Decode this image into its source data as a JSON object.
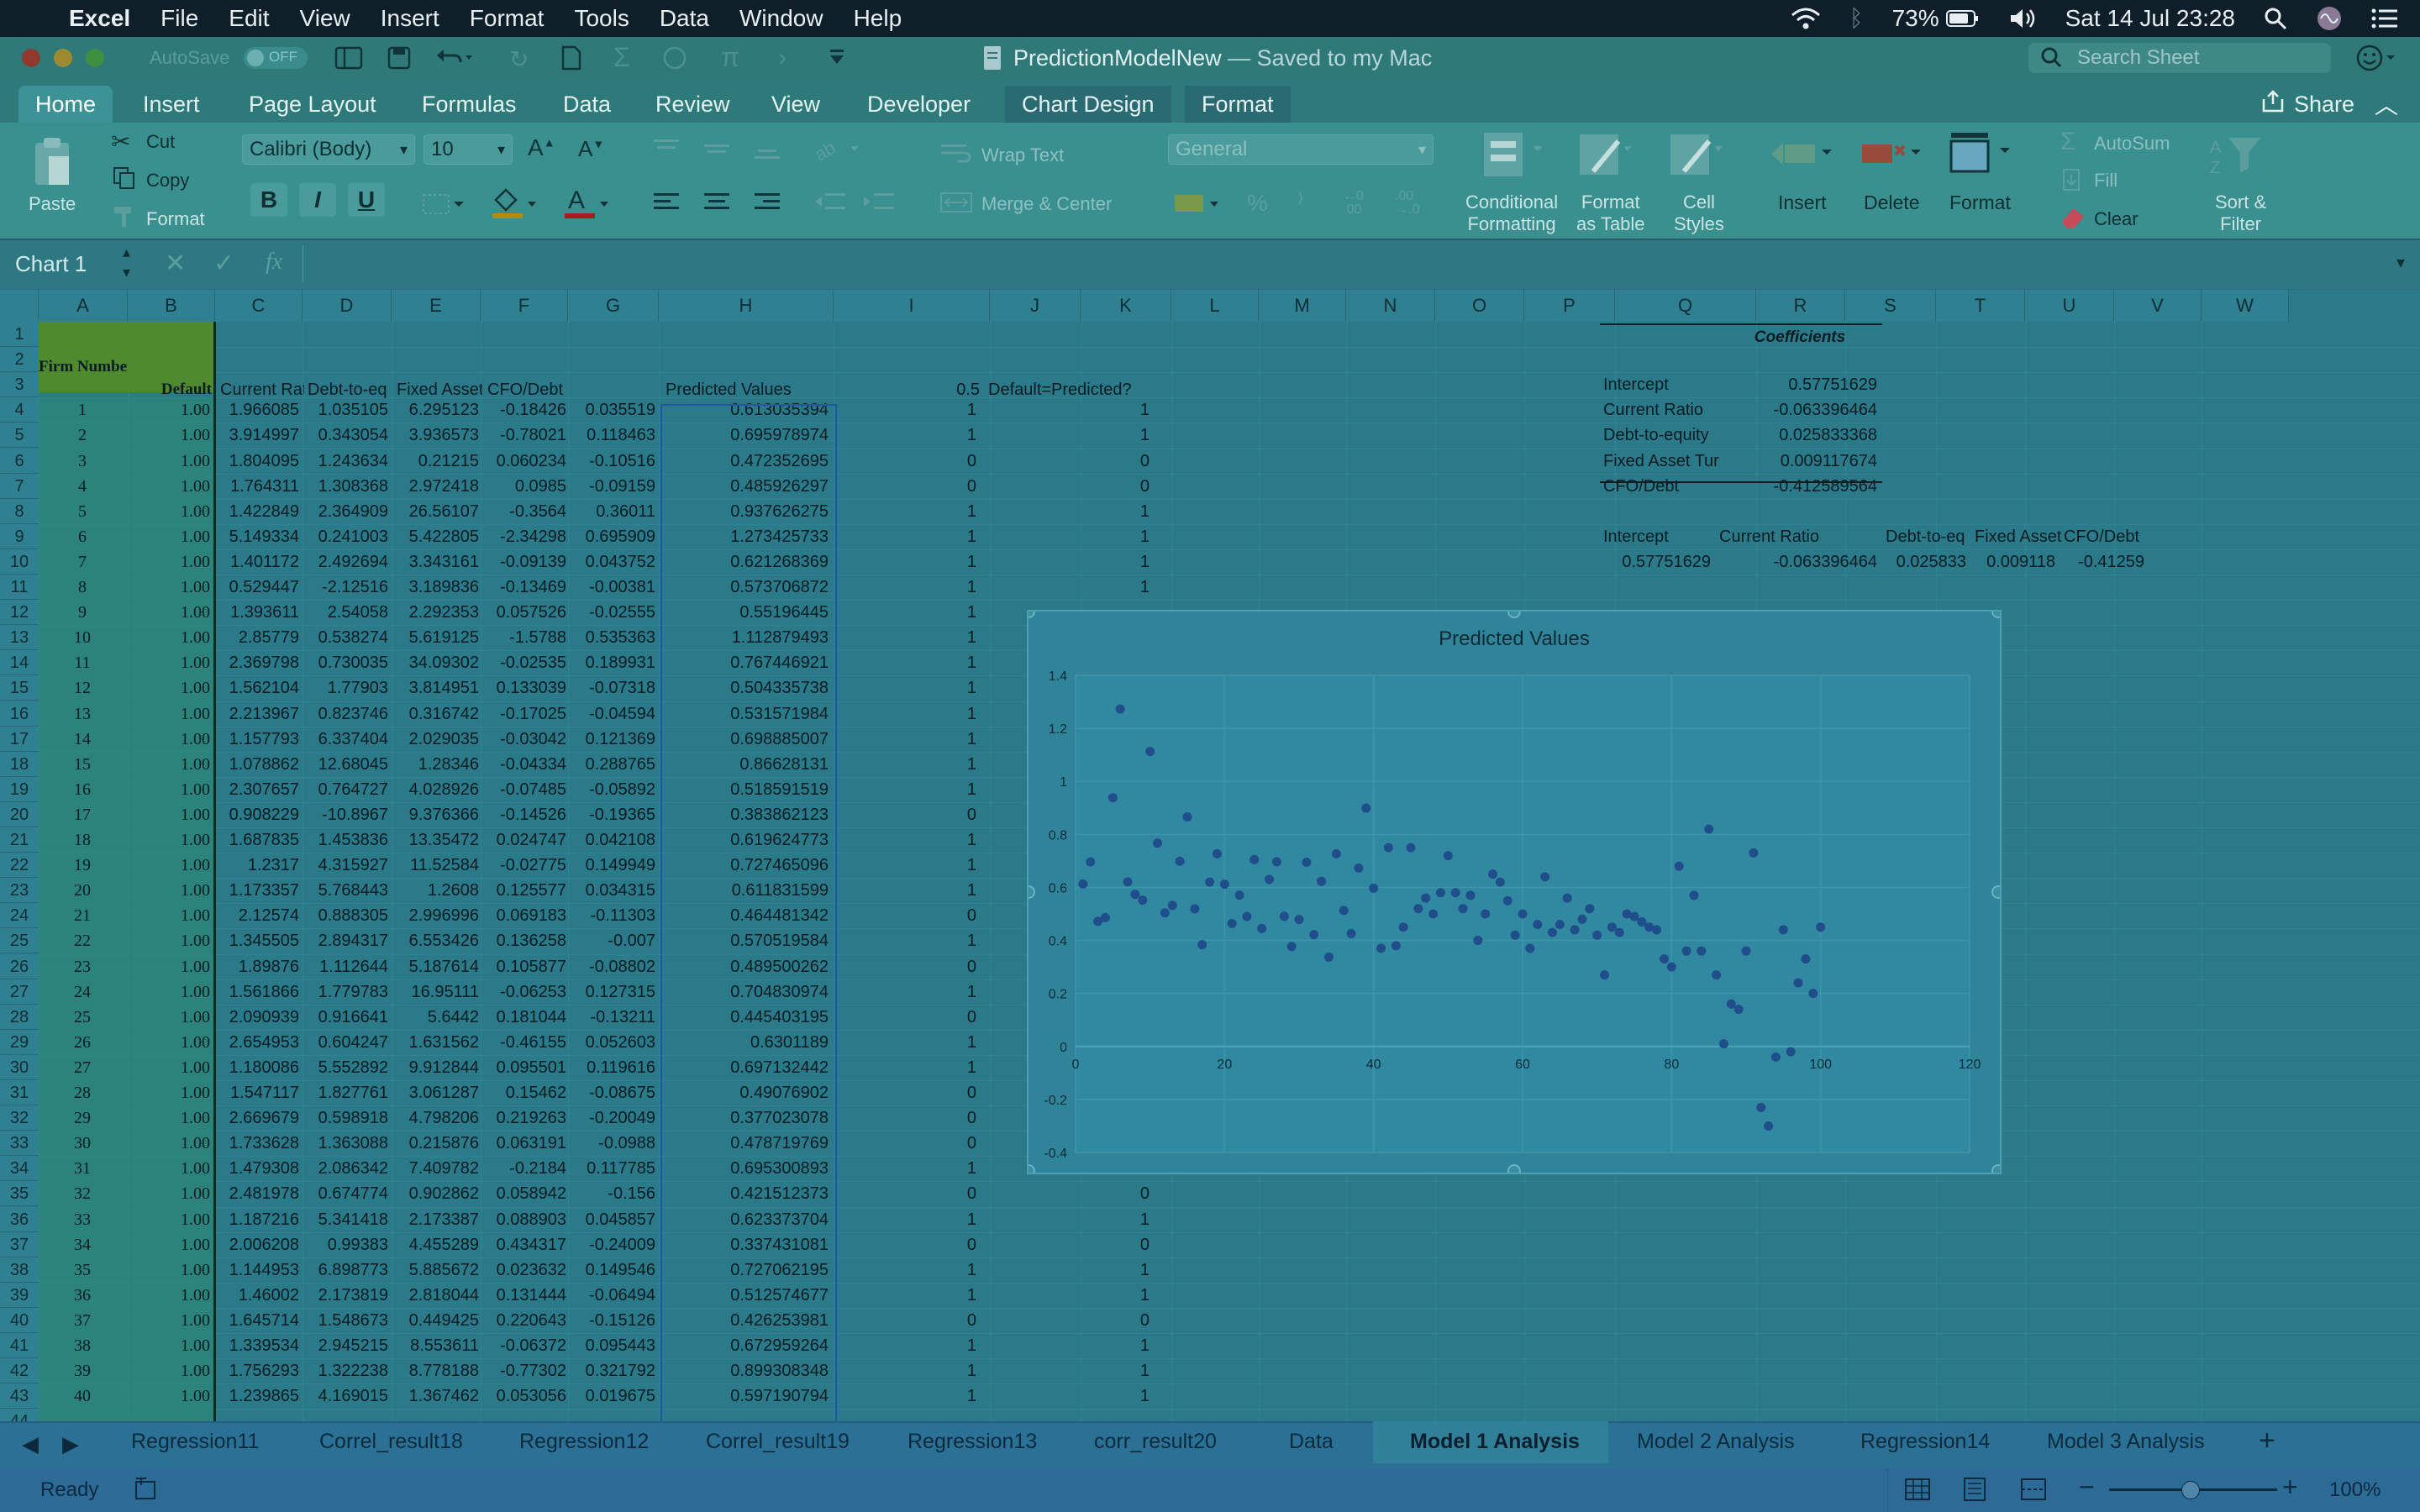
{
  "menubar": {
    "app": "Excel",
    "items": [
      "File",
      "Edit",
      "View",
      "Insert",
      "Format",
      "Tools",
      "Data",
      "Window",
      "Help"
    ],
    "battery": "73%",
    "clock": "Sat 14 Jul  23:28"
  },
  "window": {
    "title": "PredictionModelNew",
    "subtitle": "— Saved to my Mac",
    "autosave": "AutoSave",
    "autosave_state": "OFF",
    "search_placeholder": "Search Sheet"
  },
  "ribbon": {
    "tabs": [
      "Home",
      "Insert",
      "Page Layout",
      "Formulas",
      "Data",
      "Review",
      "View",
      "Developer",
      "Chart Design",
      "Format"
    ],
    "share": "Share",
    "paste": "Paste",
    "cut": "Cut",
    "copy": "Copy",
    "format": "Format",
    "font_name": "Calibri (Body)",
    "font_size": "10",
    "wrap_text": "Wrap Text",
    "merge_center": "Merge & Center",
    "number_format": "General",
    "conditional_formatting": [
      "Conditional",
      "Formatting"
    ],
    "format_as_table": [
      "Format",
      "as Table"
    ],
    "cell_styles": [
      "Cell",
      "Styles"
    ],
    "insert": "Insert",
    "delete": "Delete",
    "format_cells": "Format",
    "autosum": "AutoSum",
    "fill": "Fill",
    "clear": "Clear",
    "sort_filter": [
      "Sort &",
      "Filter"
    ],
    "bold": "B",
    "italic": "I",
    "underline": "U"
  },
  "formula_bar": {
    "name_box": "Chart 1",
    "fx": "fx"
  },
  "columns": [
    "A",
    "B",
    "C",
    "D",
    "E",
    "F",
    "G",
    "H",
    "I",
    "J",
    "K",
    "L",
    "M",
    "N",
    "O",
    "P",
    "Q",
    "R",
    "S",
    "T",
    "U",
    "V",
    "W"
  ],
  "header_row": {
    "A": "Firm Number",
    "B": "Default",
    "C": "Current Rat",
    "D": "Debt-to-eq",
    "E": "Fixed Asset",
    "F": "CFO/Debt",
    "H": "Predicted Values",
    "I": "0.5",
    "J": "Default=Predicted?"
  },
  "rows": [
    [
      "1",
      "1.00",
      "1.966085",
      "1.035105",
      "6.295123",
      "-0.18426",
      "0.035519",
      "0.613035394",
      "1",
      "1"
    ],
    [
      "2",
      "1.00",
      "3.914997",
      "0.343054",
      "3.936573",
      "-0.78021",
      "0.118463",
      "0.695978974",
      "1",
      "1"
    ],
    [
      "3",
      "1.00",
      "1.804095",
      "1.243634",
      "0.21215",
      "0.060234",
      "-0.10516",
      "0.472352695",
      "0",
      "0"
    ],
    [
      "4",
      "1.00",
      "1.764311",
      "1.308368",
      "2.972418",
      "0.0985",
      "-0.09159",
      "0.485926297",
      "0",
      "0"
    ],
    [
      "5",
      "1.00",
      "1.422849",
      "2.364909",
      "26.56107",
      "-0.3564",
      "0.36011",
      "0.937626275",
      "1",
      "1"
    ],
    [
      "6",
      "1.00",
      "5.149334",
      "0.241003",
      "5.422805",
      "-2.34298",
      "0.695909",
      "1.273425733",
      "1",
      "1"
    ],
    [
      "7",
      "1.00",
      "1.401172",
      "2.492694",
      "3.343161",
      "-0.09139",
      "0.043752",
      "0.621268369",
      "1",
      "1"
    ],
    [
      "8",
      "1.00",
      "0.529447",
      "-2.12516",
      "3.189836",
      "-0.13469",
      "-0.00381",
      "0.573706872",
      "1",
      "1"
    ],
    [
      "9",
      "1.00",
      "1.393611",
      "2.54058",
      "2.292353",
      "0.057526",
      "-0.02555",
      "0.55196445",
      "1",
      ""
    ],
    [
      "10",
      "1.00",
      "2.85779",
      "0.538274",
      "5.619125",
      "-1.5788",
      "0.535363",
      "1.112879493",
      "1",
      ""
    ],
    [
      "11",
      "1.00",
      "2.369798",
      "0.730035",
      "34.09302",
      "-0.02535",
      "0.189931",
      "0.767446921",
      "1",
      ""
    ],
    [
      "12",
      "1.00",
      "1.562104",
      "1.77903",
      "3.814951",
      "0.133039",
      "-0.07318",
      "0.504335738",
      "1",
      ""
    ],
    [
      "13",
      "1.00",
      "2.213967",
      "0.823746",
      "0.316742",
      "-0.17025",
      "-0.04594",
      "0.531571984",
      "1",
      ""
    ],
    [
      "14",
      "1.00",
      "1.157793",
      "6.337404",
      "2.029035",
      "-0.03042",
      "0.121369",
      "0.698885007",
      "1",
      ""
    ],
    [
      "15",
      "1.00",
      "1.078862",
      "12.68045",
      "1.28346",
      "-0.04334",
      "0.288765",
      "0.86628131",
      "1",
      ""
    ],
    [
      "16",
      "1.00",
      "2.307657",
      "0.764727",
      "4.028926",
      "-0.07485",
      "-0.05892",
      "0.518591519",
      "1",
      ""
    ],
    [
      "17",
      "1.00",
      "0.908229",
      "-10.8967",
      "9.376366",
      "-0.14526",
      "-0.19365",
      "0.383862123",
      "0",
      ""
    ],
    [
      "18",
      "1.00",
      "1.687835",
      "1.453836",
      "13.35472",
      "0.024747",
      "0.042108",
      "0.619624773",
      "1",
      ""
    ],
    [
      "19",
      "1.00",
      "1.2317",
      "4.315927",
      "11.52584",
      "-0.02775",
      "0.149949",
      "0.727465096",
      "1",
      ""
    ],
    [
      "20",
      "1.00",
      "1.173357",
      "5.768443",
      "1.2608",
      "0.125577",
      "0.034315",
      "0.611831599",
      "1",
      ""
    ],
    [
      "21",
      "1.00",
      "2.12574",
      "0.888305",
      "2.996996",
      "0.069183",
      "-0.11303",
      "0.464481342",
      "0",
      ""
    ],
    [
      "22",
      "1.00",
      "1.345505",
      "2.894317",
      "6.553426",
      "0.136258",
      "-0.007",
      "0.570519584",
      "1",
      ""
    ],
    [
      "23",
      "1.00",
      "1.89876",
      "1.112644",
      "5.187614",
      "0.105877",
      "-0.08802",
      "0.489500262",
      "0",
      ""
    ],
    [
      "24",
      "1.00",
      "1.561866",
      "1.779783",
      "16.95111",
      "-0.06253",
      "0.127315",
      "0.704830974",
      "1",
      ""
    ],
    [
      "25",
      "1.00",
      "2.090939",
      "0.916641",
      "5.6442",
      "0.181044",
      "-0.13211",
      "0.445403195",
      "0",
      ""
    ],
    [
      "26",
      "1.00",
      "2.654953",
      "0.604247",
      "1.631562",
      "-0.46155",
      "0.052603",
      "0.6301189",
      "1",
      ""
    ],
    [
      "27",
      "1.00",
      "1.180086",
      "5.552892",
      "9.912844",
      "0.095501",
      "0.119616",
      "0.697132442",
      "1",
      ""
    ],
    [
      "28",
      "1.00",
      "1.547117",
      "1.827761",
      "3.061287",
      "0.15462",
      "-0.08675",
      "0.49076902",
      "0",
      ""
    ],
    [
      "29",
      "1.00",
      "2.669679",
      "0.598918",
      "4.798206",
      "0.219263",
      "-0.20049",
      "0.377023078",
      "0",
      ""
    ],
    [
      "30",
      "1.00",
      "1.733628",
      "1.363088",
      "0.215876",
      "0.063191",
      "-0.0988",
      "0.478719769",
      "0",
      ""
    ],
    [
      "31",
      "1.00",
      "1.479308",
      "2.086342",
      "7.409782",
      "-0.2184",
      "0.117785",
      "0.695300893",
      "1",
      ""
    ],
    [
      "32",
      "1.00",
      "2.481978",
      "0.674774",
      "0.902862",
      "0.058942",
      "-0.156",
      "0.421512373",
      "0",
      "0"
    ],
    [
      "33",
      "1.00",
      "1.187216",
      "5.341418",
      "2.173387",
      "0.088903",
      "0.045857",
      "0.623373704",
      "1",
      "1"
    ],
    [
      "34",
      "1.00",
      "2.006208",
      "0.99383",
      "4.455289",
      "0.434317",
      "-0.24009",
      "0.337431081",
      "0",
      "0"
    ],
    [
      "35",
      "1.00",
      "1.144953",
      "6.898773",
      "5.885672",
      "0.023632",
      "0.149546",
      "0.727062195",
      "1",
      "1"
    ],
    [
      "36",
      "1.00",
      "1.46002",
      "2.173819",
      "2.818044",
      "0.131444",
      "-0.06494",
      "0.512574677",
      "1",
      "1"
    ],
    [
      "37",
      "1.00",
      "1.645714",
      "1.548673",
      "0.449425",
      "0.220643",
      "-0.15126",
      "0.426253981",
      "0",
      "0"
    ],
    [
      "38",
      "1.00",
      "1.339534",
      "2.945215",
      "8.553611",
      "-0.06372",
      "0.095443",
      "0.672959264",
      "1",
      "1"
    ],
    [
      "39",
      "1.00",
      "1.756293",
      "1.322238",
      "8.778188",
      "-0.77302",
      "0.321792",
      "0.899308348",
      "1",
      "1"
    ],
    [
      "40",
      "1.00",
      "1.239865",
      "4.169015",
      "1.367462",
      "0.053056",
      "0.019675",
      "0.597190794",
      "1",
      "1"
    ]
  ],
  "coefficients": {
    "title": "Coefficients",
    "labels": [
      "Intercept",
      "Current Ratio",
      "Debt-to-equity",
      "Fixed Asset Tur",
      "CFO/Debt"
    ],
    "values": [
      "0.57751629",
      "-0.063396464",
      "0.025833368",
      "0.009117674",
      "-0.412589564"
    ],
    "row_headers": [
      "Intercept",
      "Current Ratio",
      "Debt-to-eq",
      "Fixed Asset",
      "CFO/Debt"
    ],
    "row_values": [
      "0.57751629",
      "-0.063396464",
      "0.025833",
      "0.009118",
      "-0.41259"
    ]
  },
  "sheet_tabs": {
    "tabs": [
      "Regression11",
      "Correl_result18",
      "Regression12",
      "Correl_result19",
      "Regression13",
      "corr_result20",
      "Data",
      "Model 1 Analysis",
      "Model 2 Analysis",
      "Regression14",
      "Model 3 Analysis"
    ],
    "active": "Model 1 Analysis",
    "add": "+"
  },
  "status": {
    "ready": "Ready",
    "zoom": "100%"
  },
  "chart_data": {
    "type": "scatter",
    "title": "Predicted Values",
    "xlim": [
      0,
      120
    ],
    "ylim": [
      -0.4,
      1.4
    ],
    "xticks": [
      "0",
      "20",
      "40",
      "60",
      "80",
      "100",
      "120"
    ],
    "yticks": [
      "-0.4",
      "-0.2",
      "0",
      "0.2",
      "0.4",
      "0.6",
      "0.8",
      "1",
      "1.2",
      "1.4"
    ],
    "grid": true,
    "legend": "none",
    "color": "#1f4e8a",
    "series": [
      {
        "x": [
          1,
          2,
          3,
          4,
          5,
          6,
          7,
          8,
          9,
          10,
          11,
          12,
          13,
          14,
          15,
          16,
          17,
          18,
          19,
          20,
          21,
          22,
          23,
          24,
          25,
          26,
          27,
          28,
          29,
          30,
          31,
          32,
          33,
          34,
          35,
          36,
          37,
          38,
          39,
          40,
          41,
          42,
          43,
          44,
          45,
          46,
          47,
          48,
          49,
          50,
          51,
          52,
          53,
          54,
          55,
          56,
          57,
          58,
          59,
          60,
          61,
          62,
          63,
          64,
          65,
          66,
          67,
          68,
          69,
          70,
          71,
          72,
          73,
          74,
          75,
          76,
          77,
          78,
          79,
          80,
          81,
          82,
          83,
          84,
          85,
          86,
          87,
          88,
          89,
          90,
          91,
          92,
          93,
          94,
          95,
          96,
          97,
          98,
          99,
          100
        ],
        "y": [
          0.613,
          0.696,
          0.472,
          0.486,
          0.938,
          1.273,
          0.621,
          0.574,
          0.552,
          1.113,
          0.767,
          0.504,
          0.532,
          0.699,
          0.866,
          0.519,
          0.384,
          0.62,
          0.727,
          0.612,
          0.464,
          0.571,
          0.49,
          0.705,
          0.445,
          0.63,
          0.697,
          0.491,
          0.377,
          0.479,
          0.695,
          0.422,
          0.623,
          0.337,
          0.727,
          0.513,
          0.426,
          0.673,
          0.899,
          0.597,
          0.37,
          0.75,
          0.38,
          0.45,
          0.75,
          0.52,
          0.56,
          0.5,
          0.58,
          0.72,
          0.58,
          0.52,
          0.57,
          0.4,
          0.5,
          0.65,
          0.62,
          0.55,
          0.42,
          0.5,
          0.37,
          0.46,
          0.64,
          0.43,
          0.46,
          0.56,
          0.44,
          0.48,
          0.52,
          0.42,
          0.27,
          0.45,
          0.43,
          0.5,
          0.49,
          0.47,
          0.45,
          0.44,
          0.33,
          0.3,
          0.68,
          0.36,
          0.57,
          0.36,
          0.82,
          0.27,
          0.01,
          0.16,
          0.14,
          0.36,
          0.73,
          -0.23,
          -0.3,
          -0.04,
          0.44,
          -0.02,
          0.24,
          0.33,
          0.2,
          0.45
        ]
      }
    ]
  }
}
